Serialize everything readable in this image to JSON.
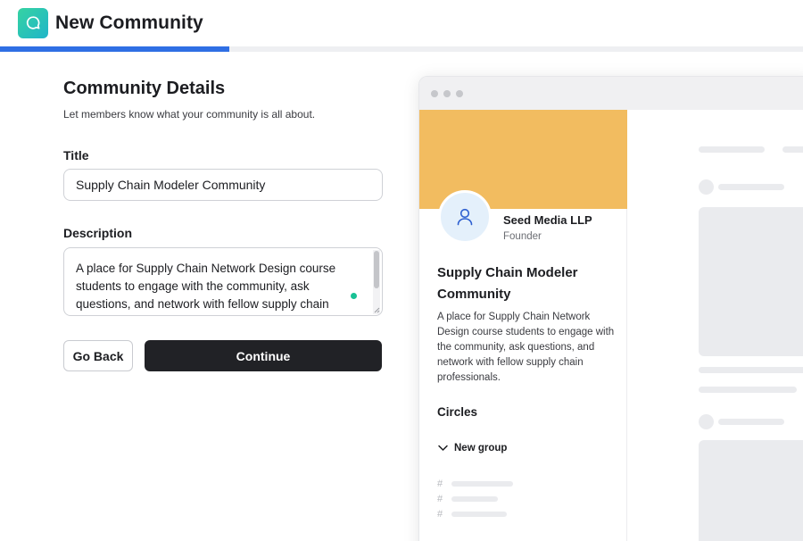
{
  "header": {
    "title": "New Community",
    "logo_icon": "chat-bubble-icon",
    "brand_colors": [
      "#36d3a2",
      "#1fb5c9"
    ]
  },
  "progress": {
    "fraction": 0.285,
    "color": "#2f6fe4"
  },
  "form": {
    "section_title": "Community Details",
    "section_subtitle": "Let members know what your community is all about.",
    "title_label": "Title",
    "title_value": "Supply Chain Modeler Community",
    "description_label": "Description",
    "description_value": "A place for Supply Chain Network Design course students to engage with the community, ask questions, and network with fellow supply chain",
    "back_label": "Go Back",
    "continue_label": "Continue"
  },
  "preview": {
    "cover_color": "#f2bc60",
    "avatar_icon": "user-icon",
    "org_name": "Seed Media LLP",
    "org_role": "Founder",
    "community_name": "Supply Chain Modeler Community",
    "community_description": "A place for Supply Chain Network Design course students to engage with the community, ask questions, and network with fellow supply chain professionals.",
    "circles_heading": "Circles",
    "group_label": "New group",
    "channel_icon": "#"
  }
}
